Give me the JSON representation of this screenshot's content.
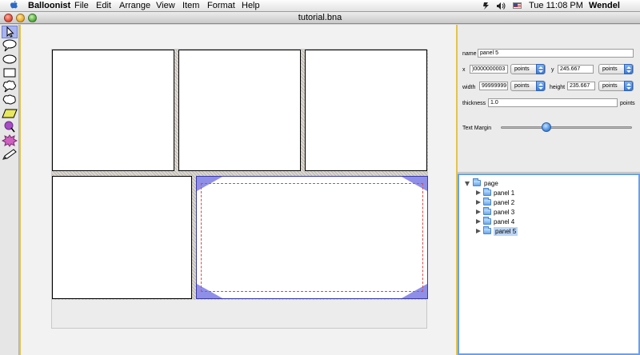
{
  "menubar": {
    "app_name": "Balloonist",
    "menus": [
      "File",
      "Edit",
      "Arrange",
      "View",
      "Item",
      "Format",
      "Help"
    ],
    "clock": "Tue 11:08 PM",
    "user": "Wendel Sims",
    "icons": [
      "apple-icon",
      "script-icon",
      "volume-icon",
      "flag-icon"
    ]
  },
  "window": {
    "title": "tutorial.bna"
  },
  "toolbox": {
    "tools": [
      "arrow-tool",
      "speech-balloon-tool",
      "oval-tool",
      "rectangle-tool",
      "cloud-balloon-tool",
      "thought-balloon-tool",
      "caption-tool",
      "pin-tool",
      "burst-tool",
      "pencil-tool"
    ]
  },
  "inspector": {
    "name_label": "name",
    "name_value": "panel 5",
    "x_label": "x",
    "x_value": ")0000000003",
    "x_unit": "points",
    "y_label": "y",
    "y_value": "245.667",
    "y_unit": "points",
    "width_label": "width",
    "width_value": "99999999",
    "width_unit": "points",
    "height_label": "height",
    "height_value": "235.667",
    "height_unit": "points",
    "thickness_label": "thickness",
    "thickness_value": "1.0",
    "thickness_unit": "points",
    "text_margin_label": "Text Margin",
    "text_margin_level": 0.35
  },
  "outline": {
    "root": "page",
    "children": [
      "panel 1",
      "panel 2",
      "panel 3",
      "panel 4",
      "panel 5"
    ],
    "selected": "panel 5"
  },
  "colors": {
    "selection_fill": "#8f8fe8",
    "margin_dash": "#e04848",
    "outline_border": "#6aa0e8"
  }
}
